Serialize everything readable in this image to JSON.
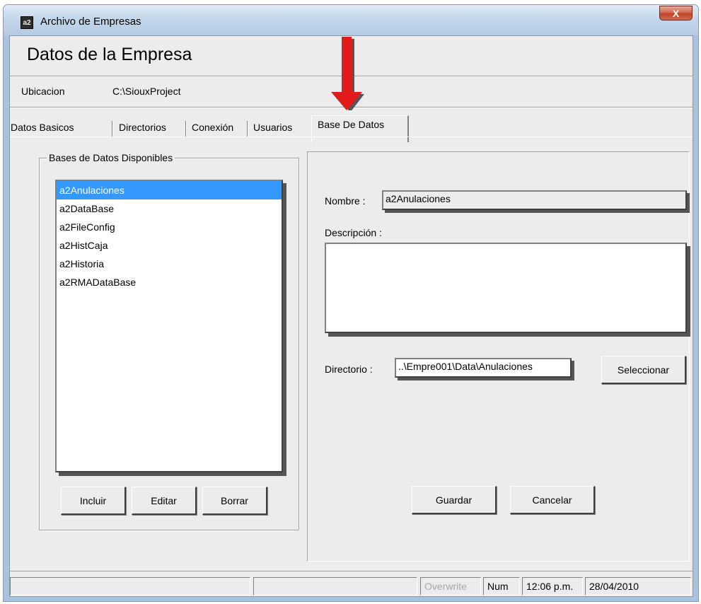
{
  "window": {
    "title": "Archivo de Empresas",
    "icon_name": "app-logo-icon",
    "close_label": "X"
  },
  "header": {
    "title": "Datos de la Empresa"
  },
  "location": {
    "label": "Ubicacion",
    "value": "C:\\SiouxProject"
  },
  "tabs": [
    {
      "label": "Datos Basicos",
      "active": false
    },
    {
      "label": "Directorios",
      "active": false
    },
    {
      "label": "Conexión",
      "active": false
    },
    {
      "label": "Usuarios",
      "active": false
    },
    {
      "label": "Base De Datos",
      "active": true
    }
  ],
  "databases": {
    "group_title": "Bases de Datos Disponibles",
    "items": [
      "a2Anulaciones",
      "a2DataBase",
      "a2FileConfig",
      "a2HistCaja",
      "a2Historia",
      "a2RMADataBase"
    ],
    "selected_index": 0,
    "buttons": {
      "include": "Incluir",
      "edit": "Editar",
      "delete": "Borrar"
    }
  },
  "detail": {
    "name_label": "Nombre :",
    "name_value": "a2Anulaciones",
    "description_label": "Descripción :",
    "description_value": "",
    "directory_label": "Directorio :",
    "directory_value": "..\\Empre001\\Data\\Anulaciones",
    "select_button": "Seleccionar",
    "save_button": "Guardar",
    "cancel_button": "Cancelar"
  },
  "statusbar": {
    "overwrite": "Overwrite",
    "num": "Num",
    "time": "12:06 p.m.",
    "date": "28/04/2010"
  },
  "colors": {
    "selection": "#3399ff",
    "annotation_arrow": "#e11a1a",
    "close_button": "#c9503a"
  }
}
